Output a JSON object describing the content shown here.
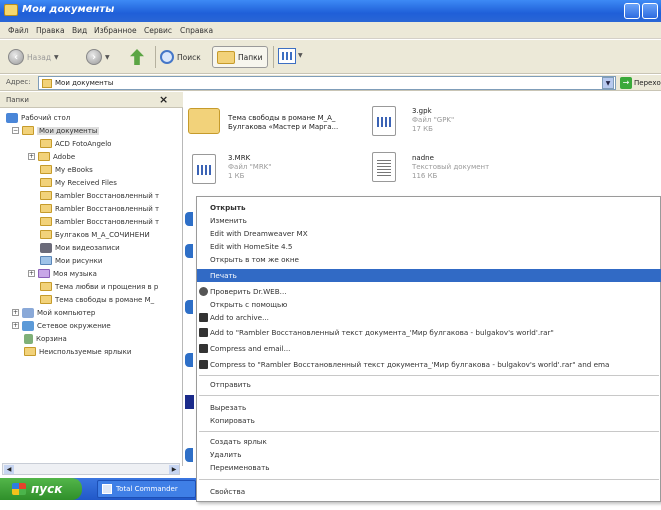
{
  "window": {
    "title": "Мои документы"
  },
  "menu": [
    "Файл",
    "Правка",
    "Вид",
    "Избранное",
    "Сервис",
    "Справка"
  ],
  "toolbar": {
    "back": "Назад",
    "search": "Поиск",
    "folders": "Папки"
  },
  "address": {
    "label": "Адрес:",
    "value": "Мои документы",
    "go": "Переход"
  },
  "left_pane": {
    "title": "Папки",
    "close": "×",
    "tree": [
      "Рабочий стол",
      "Мои документы",
      "ACD FotoAngelo",
      "Adobe",
      "My eBooks",
      "My Received Files",
      "Rambler Восстановленный т",
      "Rambler Восстановленный т",
      "Rambler Восстановленный т",
      "Булгаков М_А_СОЧИНЕНИ",
      "Мои видеозаписи",
      "Мои рисунки",
      "Моя музыка",
      "Тема любви и прощения в р",
      "Тема свободы в романе М_",
      "Мой компьютер",
      "Сетевое окружение",
      "Корзина",
      "Неиспользуемые ярлыки"
    ]
  },
  "files": [
    {
      "name": "Тема свободы в романе М_А_",
      "name2": "Булгакова «Мастер и Марга...",
      "type": "",
      "size": ""
    },
    {
      "name": "3.gpk",
      "name2": "",
      "type": "Файл \"GPK\"",
      "size": "17 КБ"
    },
    {
      "name": "3.MRK",
      "name2": "",
      "type": "Файл \"MRK\"",
      "size": "1 КБ"
    },
    {
      "name": "nadne",
      "name2": "",
      "type": "Текстовый документ",
      "size": "116 КБ"
    }
  ],
  "context_menu": [
    "Открыть",
    "Изменить",
    "Edit with Dreamweaver MX",
    "Edit with HomeSite 4.5",
    "Открыть в том же окне",
    "Печать",
    "Проверить Dr.WEB...",
    "Открыть с помощью",
    "Add to archive...",
    "Add to \"Rambler Восстановленный текст документа_'Мир булгакова - bulgakov's world'.rar\"",
    "Compress and email...",
    "Compress to \"Rambler Восстановленный текст документа_'Мир булгакова - bulgakov's world'.rar\" and ema",
    "Отправить",
    "Вырезать",
    "Копировать",
    "Создать ярлык",
    "Удалить",
    "Переименовать",
    "Свойства"
  ],
  "taskbar": {
    "start": "пуск",
    "task": "Total Commander"
  }
}
